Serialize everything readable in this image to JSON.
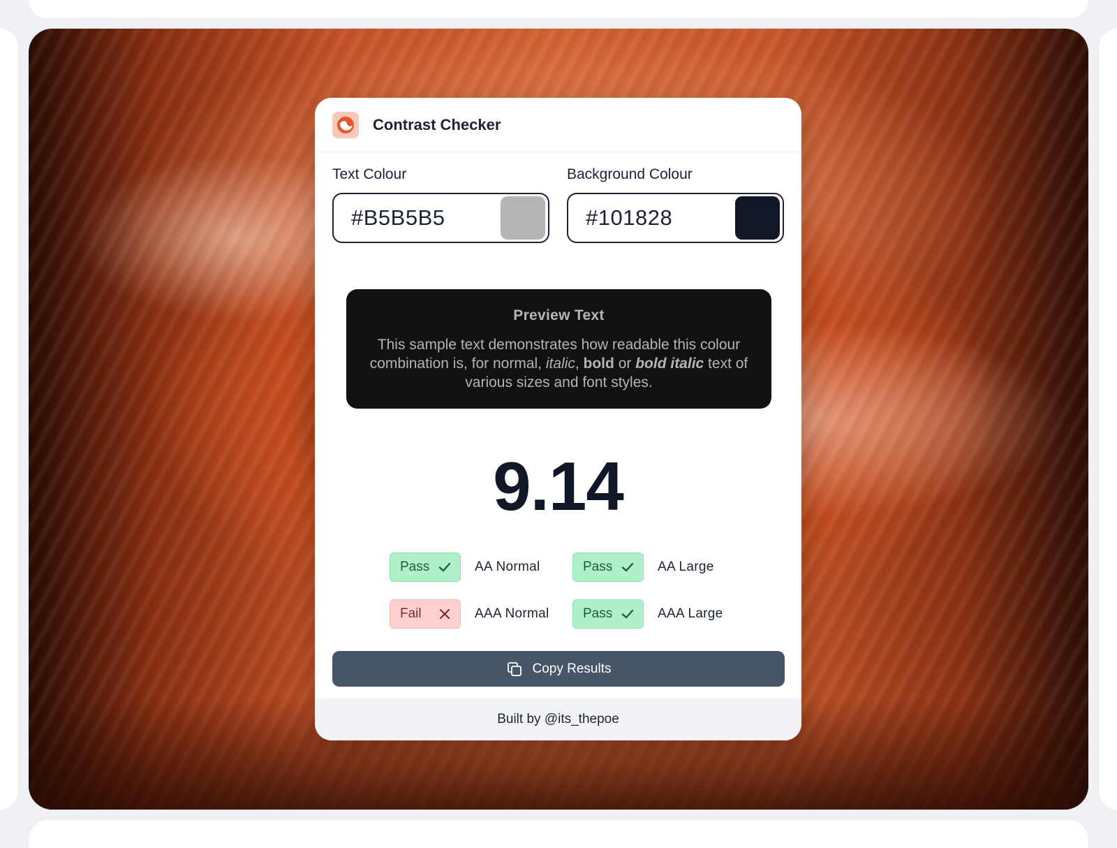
{
  "app": {
    "title": "Contrast Checker",
    "logo_icon": "contrast-logo-icon",
    "accent_color": "#e4572e"
  },
  "fields": {
    "text_label": "Text Colour",
    "text_value": "#B5B5B5",
    "background_label": "Background Colour",
    "background_value": "#101828"
  },
  "preview": {
    "title": "Preview Text",
    "body_part1": "This sample text demonstrates how readable this colour combination is, for normal, ",
    "italic": "italic",
    "sep1": ", ",
    "bold": "bold",
    "sep2": " or ",
    "bold_italic": "bold italic",
    "body_part2": " text of various sizes and font styles."
  },
  "ratio": "9.14",
  "results": [
    {
      "status": "Pass",
      "icon": "check-icon",
      "label": "AA Normal"
    },
    {
      "status": "Pass",
      "icon": "check-icon",
      "label": "AA Large"
    },
    {
      "status": "Fail",
      "icon": "x-icon",
      "label": "AAA Normal"
    },
    {
      "status": "Pass",
      "icon": "check-icon",
      "label": "AAA Large"
    }
  ],
  "copy_button": {
    "label": "Copy Results",
    "icon": "copy-icon"
  },
  "footer": {
    "text": "Built by @its_thepoe"
  }
}
